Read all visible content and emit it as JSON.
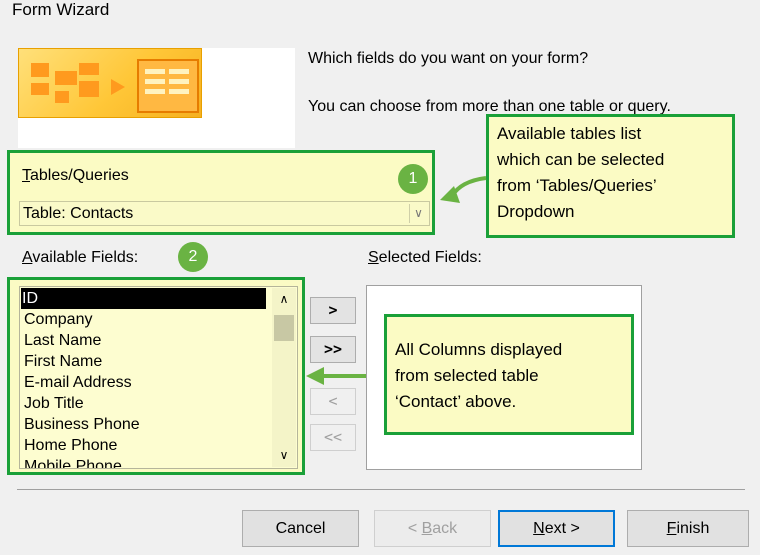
{
  "window": {
    "title": "Form Wizard"
  },
  "intro": {
    "question": "Which fields do you want on your form?",
    "hint": "You can choose from more than one table or query."
  },
  "tables_queries": {
    "label_accel": "T",
    "label_rest": "ables/Queries",
    "selected": "Table: Contacts",
    "badge": "1"
  },
  "callout_tables": {
    "lines": [
      "Available tables list",
      "which can be selected",
      "from ‘Tables/Queries’",
      "Dropdown"
    ]
  },
  "available_fields": {
    "label_accel": "A",
    "label_rest": "vailable Fields:",
    "badge": "2",
    "items": [
      "ID",
      "Company",
      "Last Name",
      "First Name",
      "E-mail Address",
      "Job Title",
      "Business Phone",
      "Home Phone",
      "Mobile Phone"
    ]
  },
  "selected_fields": {
    "label_accel": "S",
    "label_rest": "elected Fields:"
  },
  "transfer_buttons": {
    "add_one": ">",
    "add_all": ">>",
    "remove_one": "<",
    "remove_all": "<<"
  },
  "callout_columns": {
    "lines": [
      "All Columns displayed",
      "from selected table",
      "‘Contact’ above."
    ]
  },
  "buttons": {
    "cancel": "Cancel",
    "back_prefix": "< ",
    "back_accel": "B",
    "back_rest": "ack",
    "next_accel": "N",
    "next_rest": "ext >",
    "finish_accel": "F",
    "finish_rest": "inish"
  },
  "colors": {
    "highlight_fill": "#fbfbc4",
    "highlight_border": "#1aa038",
    "badge": "#6ab343",
    "arrow": "#6ab343"
  },
  "icons": {
    "dropdown": "chevron-down-icon",
    "scroll_up": "chevron-up-icon",
    "scroll_down": "chevron-down-icon"
  }
}
